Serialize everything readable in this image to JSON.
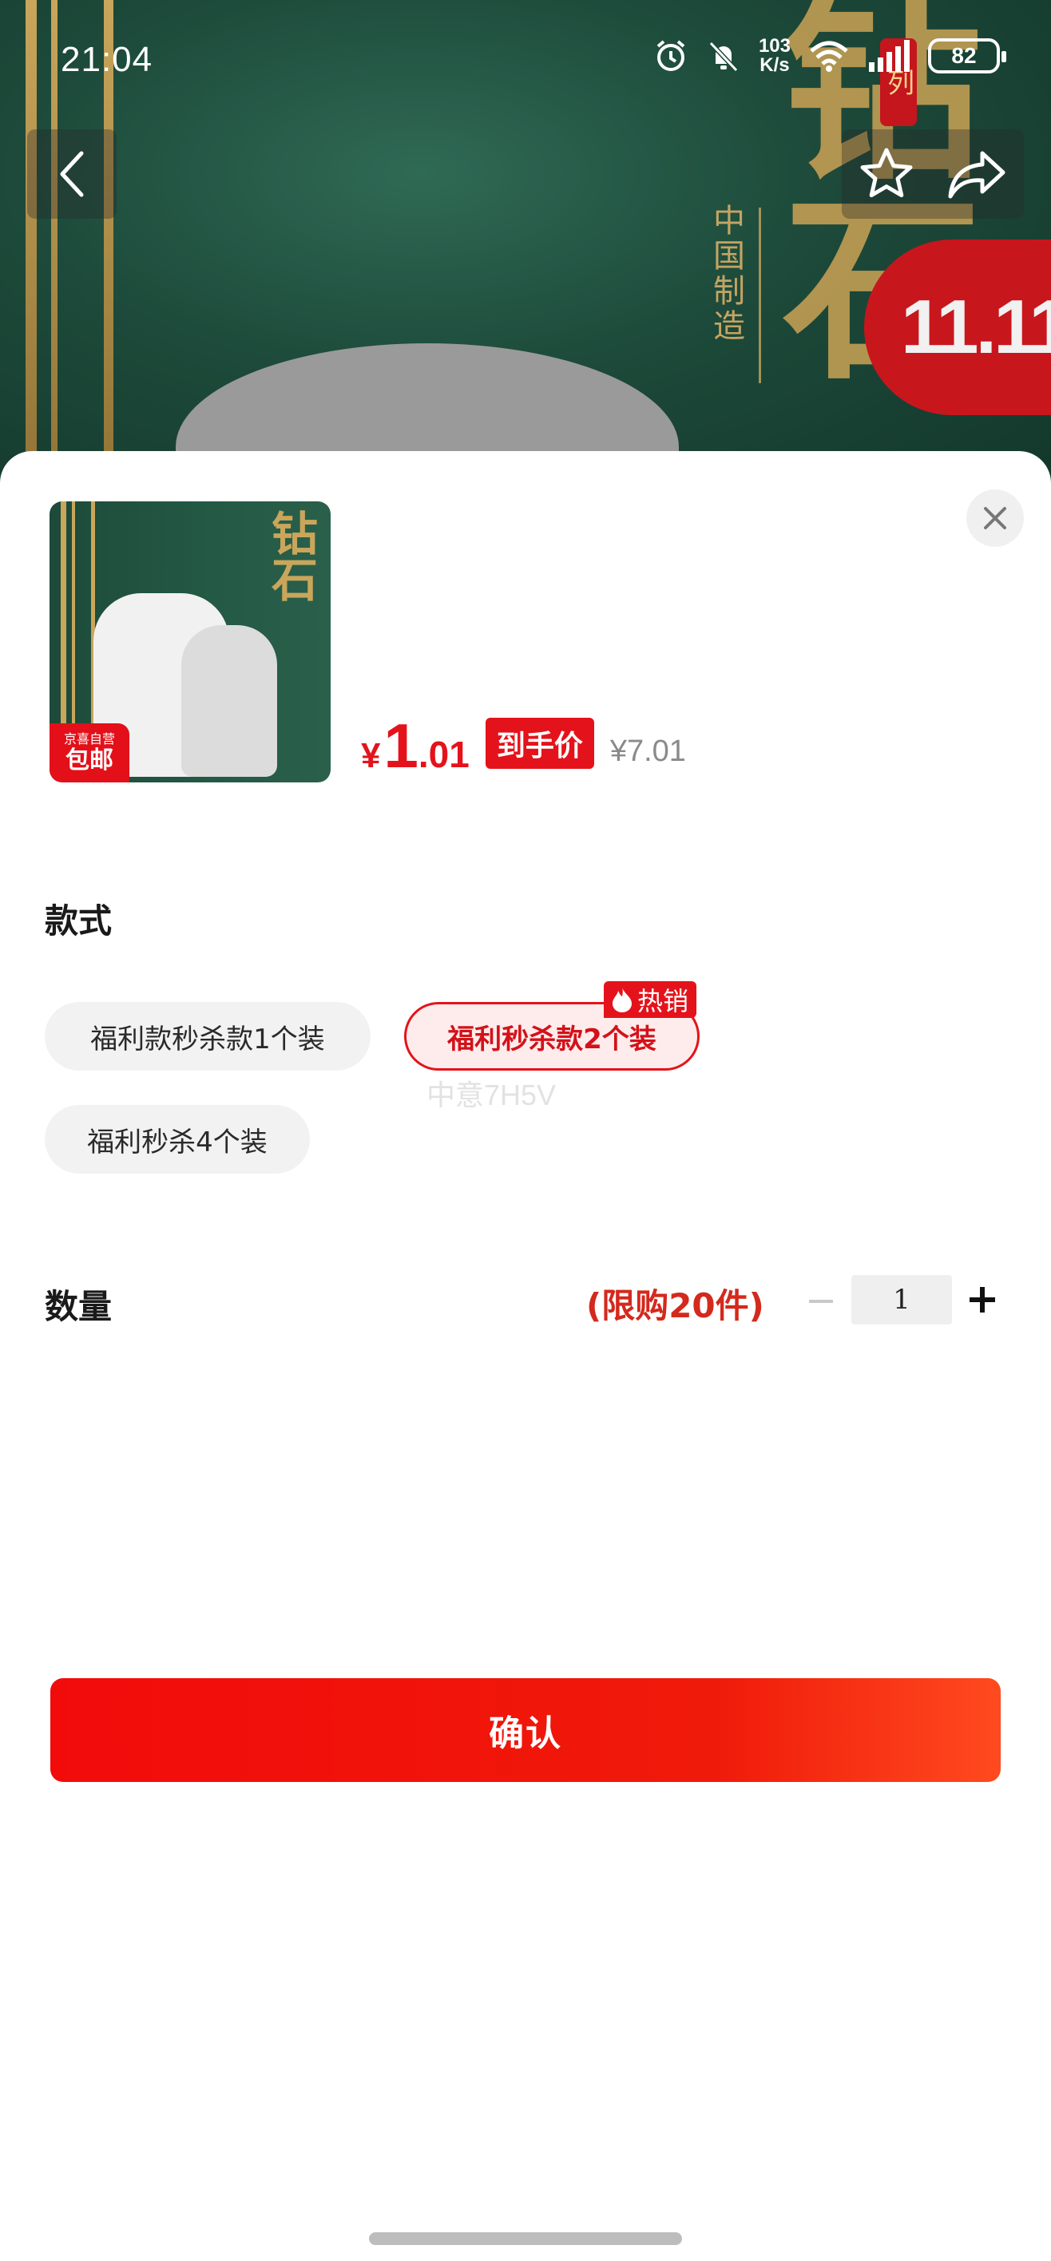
{
  "status_bar": {
    "time": "21:04",
    "net_speed_value": "103",
    "net_speed_unit": "K/s",
    "battery": "82"
  },
  "background": {
    "brand_text": "钻石",
    "made_in_text": "中国制造",
    "series_text": "列",
    "promo_text": "11.11"
  },
  "nav": {
    "back_icon": "chevron-left-icon",
    "favorite_icon": "star-icon",
    "share_icon": "share-icon"
  },
  "product": {
    "thumbnail_brand": "钻石",
    "thumb_tag_top": "京喜自营",
    "thumb_tag_bottom": "包邮",
    "price_currency": "¥",
    "price_integer": "1",
    "price_decimal": ".01",
    "deal_label": "到手价",
    "original_price": "¥7.01"
  },
  "style_section": {
    "title": "款式",
    "options": [
      {
        "label": "福利款秒杀款1个装",
        "selected": false
      },
      {
        "label": "福利秒杀款2个装",
        "selected": true
      },
      {
        "label": "福利秒杀4个装",
        "selected": false
      }
    ],
    "hot_badge": "热销",
    "watermark": "中意7H5V"
  },
  "quantity_section": {
    "title": "数量",
    "limit_text": "(限购20件)",
    "value": "1"
  },
  "confirm_label": "确认",
  "colors": {
    "accent_red": "#e4131b",
    "limit_red": "#d4291d",
    "bg_green": "#1d4a3a",
    "gold": "#c9a65b"
  }
}
